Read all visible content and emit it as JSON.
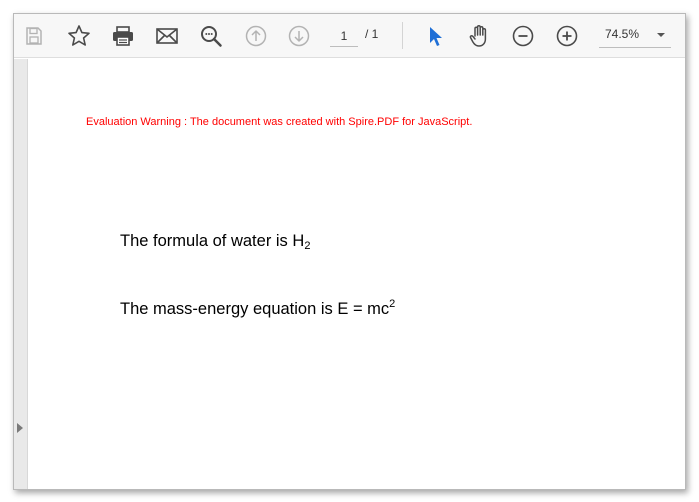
{
  "toolbar": {
    "current_page": "1",
    "page_total": "/ 1",
    "zoom": "74.5%",
    "accent_color": "#1f6fd6",
    "icons": [
      "save-icon",
      "bookmark-icon",
      "print-icon",
      "email-icon",
      "search-icon",
      "previous-page-icon",
      "next-page-icon",
      "select-cursor-icon",
      "hand-pan-icon",
      "zoom-out-icon",
      "zoom-in-icon",
      "chevron-down-icon"
    ]
  },
  "document": {
    "warning": "Evaluation Warning : The document was created with Spire.PDF for JavaScript.",
    "warning_color": "#ff0000",
    "line1_text": "The formula of water is H",
    "line1_sub": "2",
    "line2_text": "The mass-energy equation is E = mc",
    "line2_sup": "2"
  }
}
